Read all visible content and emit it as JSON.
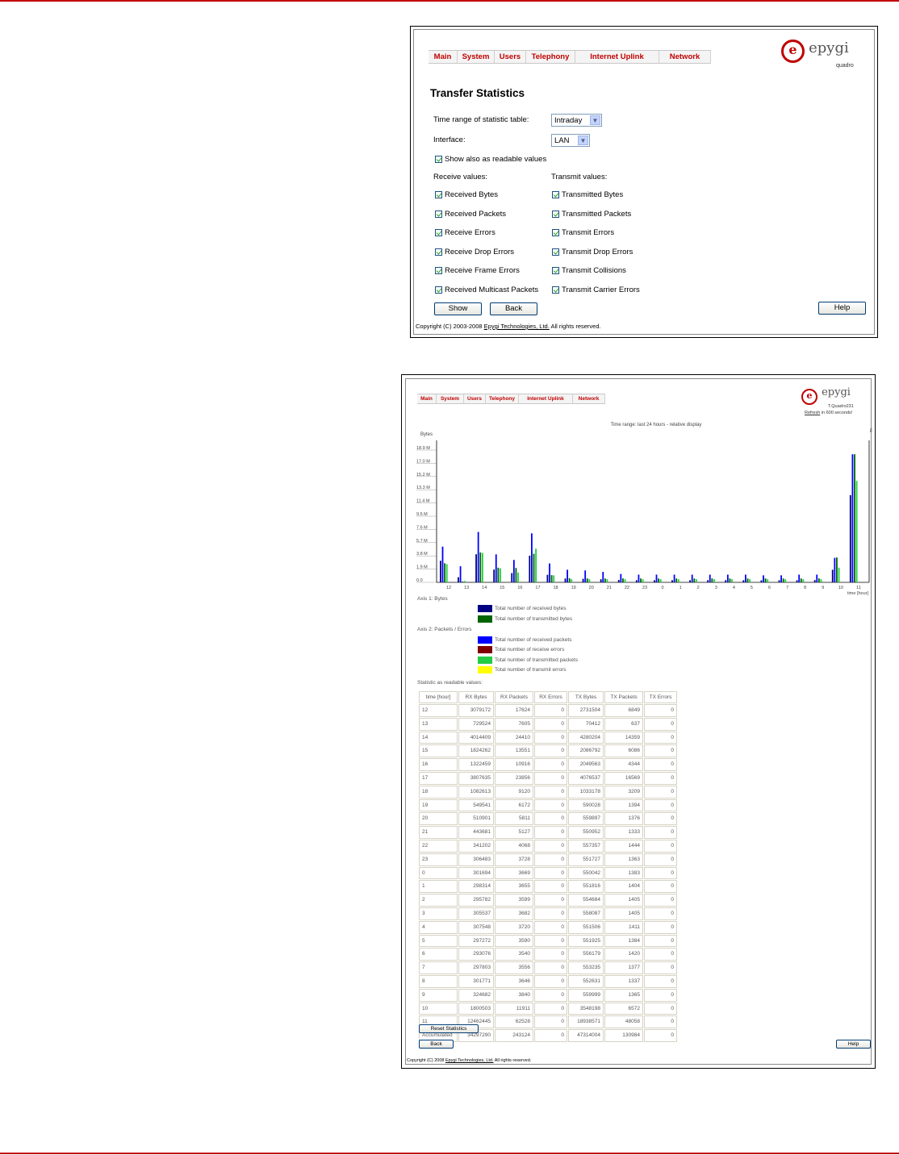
{
  "nav": [
    "Main",
    "System",
    "Users",
    "Telephony",
    "Internet Uplink",
    "Network"
  ],
  "logo": {
    "brand": "epygi",
    "product": "quadro"
  },
  "form": {
    "title": "Transfer Statistics",
    "time_range_label": "Time range of statistic table:",
    "time_range_value": "Intraday",
    "interface_label": "Interface:",
    "interface_value": "LAN",
    "show_readable": "Show also as readable values",
    "receive_header": "Receive values:",
    "transmit_header": "Transmit values:",
    "receive_items": [
      "Received Bytes",
      "Received Packets",
      "Receive Errors",
      "Receive Drop Errors",
      "Receive Frame Errors",
      "Received Multicast Packets"
    ],
    "transmit_items": [
      "Transmitted Bytes",
      "Transmitted Packets",
      "Transmit Errors",
      "Transmit Drop Errors",
      "Transmit Collisions",
      "Transmit Carrier Errors"
    ],
    "show_button": "Show",
    "back_button": "Back",
    "help_button": "Help",
    "copyright_pre": "Copyright (C) 2003-2008 ",
    "copyright_link": "Epygi Technologies, Ltd.",
    "copyright_post": " All rights reserved."
  },
  "result": {
    "device": "T.Quadro231",
    "refresh_link": "Refresh",
    "refresh_text": " in 600 seconds!",
    "legend_axis1": "Axis 1: Bytes",
    "legend_axis2": "Axis 2: Packets / Errors",
    "legend_items": [
      {
        "label": "Total number of received bytes",
        "color": "#000080"
      },
      {
        "label": "Total number of transmitted bytes",
        "color": "#006400"
      },
      {
        "label": "Total number of received packets",
        "color": "#0000ff"
      },
      {
        "label": "Total number of receive errors",
        "color": "#800000"
      },
      {
        "label": "Total number of transmitted packets",
        "color": "#22cc44"
      },
      {
        "label": "Total number of transmit errors",
        "color": "#ffff00"
      }
    ],
    "readable_title": "Statistic as readable values:",
    "table_headers": [
      "time [hour]",
      "RX Bytes",
      "RX Packets",
      "RX Errors",
      "TX Bytes",
      "TX Packets",
      "TX Errors"
    ],
    "table_rows": [
      [
        "12",
        "3079172",
        "17624",
        "0",
        "2731504",
        "6849",
        "0"
      ],
      [
        "13",
        "729524",
        "7605",
        "0",
        "70412",
        "637",
        "0"
      ],
      [
        "14",
        "4014409",
        "24410",
        "0",
        "4280204",
        "14359",
        "0"
      ],
      [
        "15",
        "1824262",
        "13551",
        "0",
        "2086792",
        "6086",
        "0"
      ],
      [
        "16",
        "1322459",
        "10916",
        "0",
        "2049563",
        "4344",
        "0"
      ],
      [
        "17",
        "3807635",
        "23856",
        "0",
        "4076537",
        "16569",
        "0"
      ],
      [
        "18",
        "1082613",
        "9120",
        "0",
        "1033178",
        "3209",
        "0"
      ],
      [
        "19",
        "549541",
        "6172",
        "0",
        "590028",
        "1394",
        "0"
      ],
      [
        "20",
        "510901",
        "5811",
        "0",
        "559897",
        "1376",
        "0"
      ],
      [
        "21",
        "443681",
        "5127",
        "0",
        "550952",
        "1333",
        "0"
      ],
      [
        "22",
        "341202",
        "4068",
        "0",
        "557357",
        "1444",
        "0"
      ],
      [
        "23",
        "306483",
        "3728",
        "0",
        "551727",
        "1363",
        "0"
      ],
      [
        "0",
        "301694",
        "3669",
        "0",
        "550042",
        "1383",
        "0"
      ],
      [
        "1",
        "298314",
        "3655",
        "0",
        "551816",
        "1404",
        "0"
      ],
      [
        "2",
        "295782",
        "3599",
        "0",
        "554684",
        "1405",
        "0"
      ],
      [
        "3",
        "305537",
        "3682",
        "0",
        "558087",
        "1405",
        "0"
      ],
      [
        "4",
        "307548",
        "3720",
        "0",
        "551506",
        "1411",
        "0"
      ],
      [
        "5",
        "297272",
        "3590",
        "0",
        "551925",
        "1384",
        "0"
      ],
      [
        "6",
        "293076",
        "3540",
        "0",
        "556179",
        "1420",
        "0"
      ],
      [
        "7",
        "297803",
        "3556",
        "0",
        "553235",
        "1377",
        "0"
      ],
      [
        "8",
        "301771",
        "3646",
        "0",
        "552631",
        "1337",
        "0"
      ],
      [
        "9",
        "324682",
        "3840",
        "0",
        "559999",
        "1365",
        "0"
      ],
      [
        "10",
        "1800503",
        "11911",
        "0",
        "3548198",
        "6572",
        "0"
      ],
      [
        "11",
        "12462445",
        "62528",
        "0",
        "18938571",
        "48058",
        "0"
      ],
      [
        "Accumulated",
        "34297290",
        "243124",
        "0",
        "47314004",
        "130984",
        "0"
      ]
    ],
    "reset_button": "Reset Statistics",
    "back_button": "Back",
    "help_button": "Help",
    "copyright_pre": "Copyright (C) 2008 ",
    "copyright_link": "Epygi Technologies, Ltd.",
    "copyright_post": " All rights reserved."
  },
  "chart_data": {
    "type": "bar",
    "title": "Time range: last 24 hours - relative display",
    "ylabel": "Bytes",
    "xlabel": "time [hour]",
    "y_ticks": [
      "0.0",
      "1.9 M",
      "3.8 M",
      "5.7 M",
      "7.6 M",
      "9.5 M",
      "11.4 M",
      "13.3 M",
      "15.2 M",
      "17.0 M",
      "18.9 M"
    ],
    "ylim": [
      0,
      18.9
    ],
    "categories": [
      "12",
      "13",
      "14",
      "15",
      "16",
      "17",
      "18",
      "19",
      "20",
      "21",
      "22",
      "23",
      "0",
      "1",
      "2",
      "3",
      "4",
      "5",
      "6",
      "7",
      "8",
      "9",
      "10",
      "11"
    ],
    "right_axis_label": "P",
    "series": [
      {
        "name": "Total number of received bytes",
        "color": "#000080",
        "values": [
          3.08,
          0.73,
          4.01,
          1.82,
          1.32,
          3.81,
          1.08,
          0.55,
          0.51,
          0.44,
          0.34,
          0.31,
          0.3,
          0.3,
          0.3,
          0.31,
          0.31,
          0.3,
          0.29,
          0.3,
          0.3,
          0.32,
          1.8,
          12.46
        ]
      },
      {
        "name": "Total number of received packets",
        "color": "#0000ff",
        "values": [
          5.1,
          2.3,
          7.2,
          4.0,
          3.2,
          7.0,
          2.7,
          1.8,
          1.7,
          1.5,
          1.2,
          1.1,
          1.1,
          1.1,
          1.1,
          1.1,
          1.1,
          1.1,
          1.0,
          1.0,
          1.1,
          1.1,
          3.5,
          18.3
        ]
      },
      {
        "name": "Total number of transmitted bytes",
        "color": "#006400",
        "values": [
          2.73,
          0.07,
          4.28,
          2.09,
          2.05,
          4.08,
          1.03,
          0.59,
          0.56,
          0.55,
          0.56,
          0.55,
          0.55,
          0.55,
          0.55,
          0.56,
          0.55,
          0.55,
          0.56,
          0.55,
          0.55,
          0.56,
          3.55,
          18.3
        ]
      },
      {
        "name": "Total number of transmitted packets",
        "color": "#22cc44",
        "values": [
          2.6,
          0.2,
          4.2,
          2.0,
          1.4,
          4.8,
          1.0,
          0.45,
          0.45,
          0.45,
          0.45,
          0.45,
          0.45,
          0.45,
          0.45,
          0.45,
          0.45,
          0.45,
          0.45,
          0.45,
          0.45,
          0.45,
          2.1,
          14.5
        ]
      }
    ]
  }
}
